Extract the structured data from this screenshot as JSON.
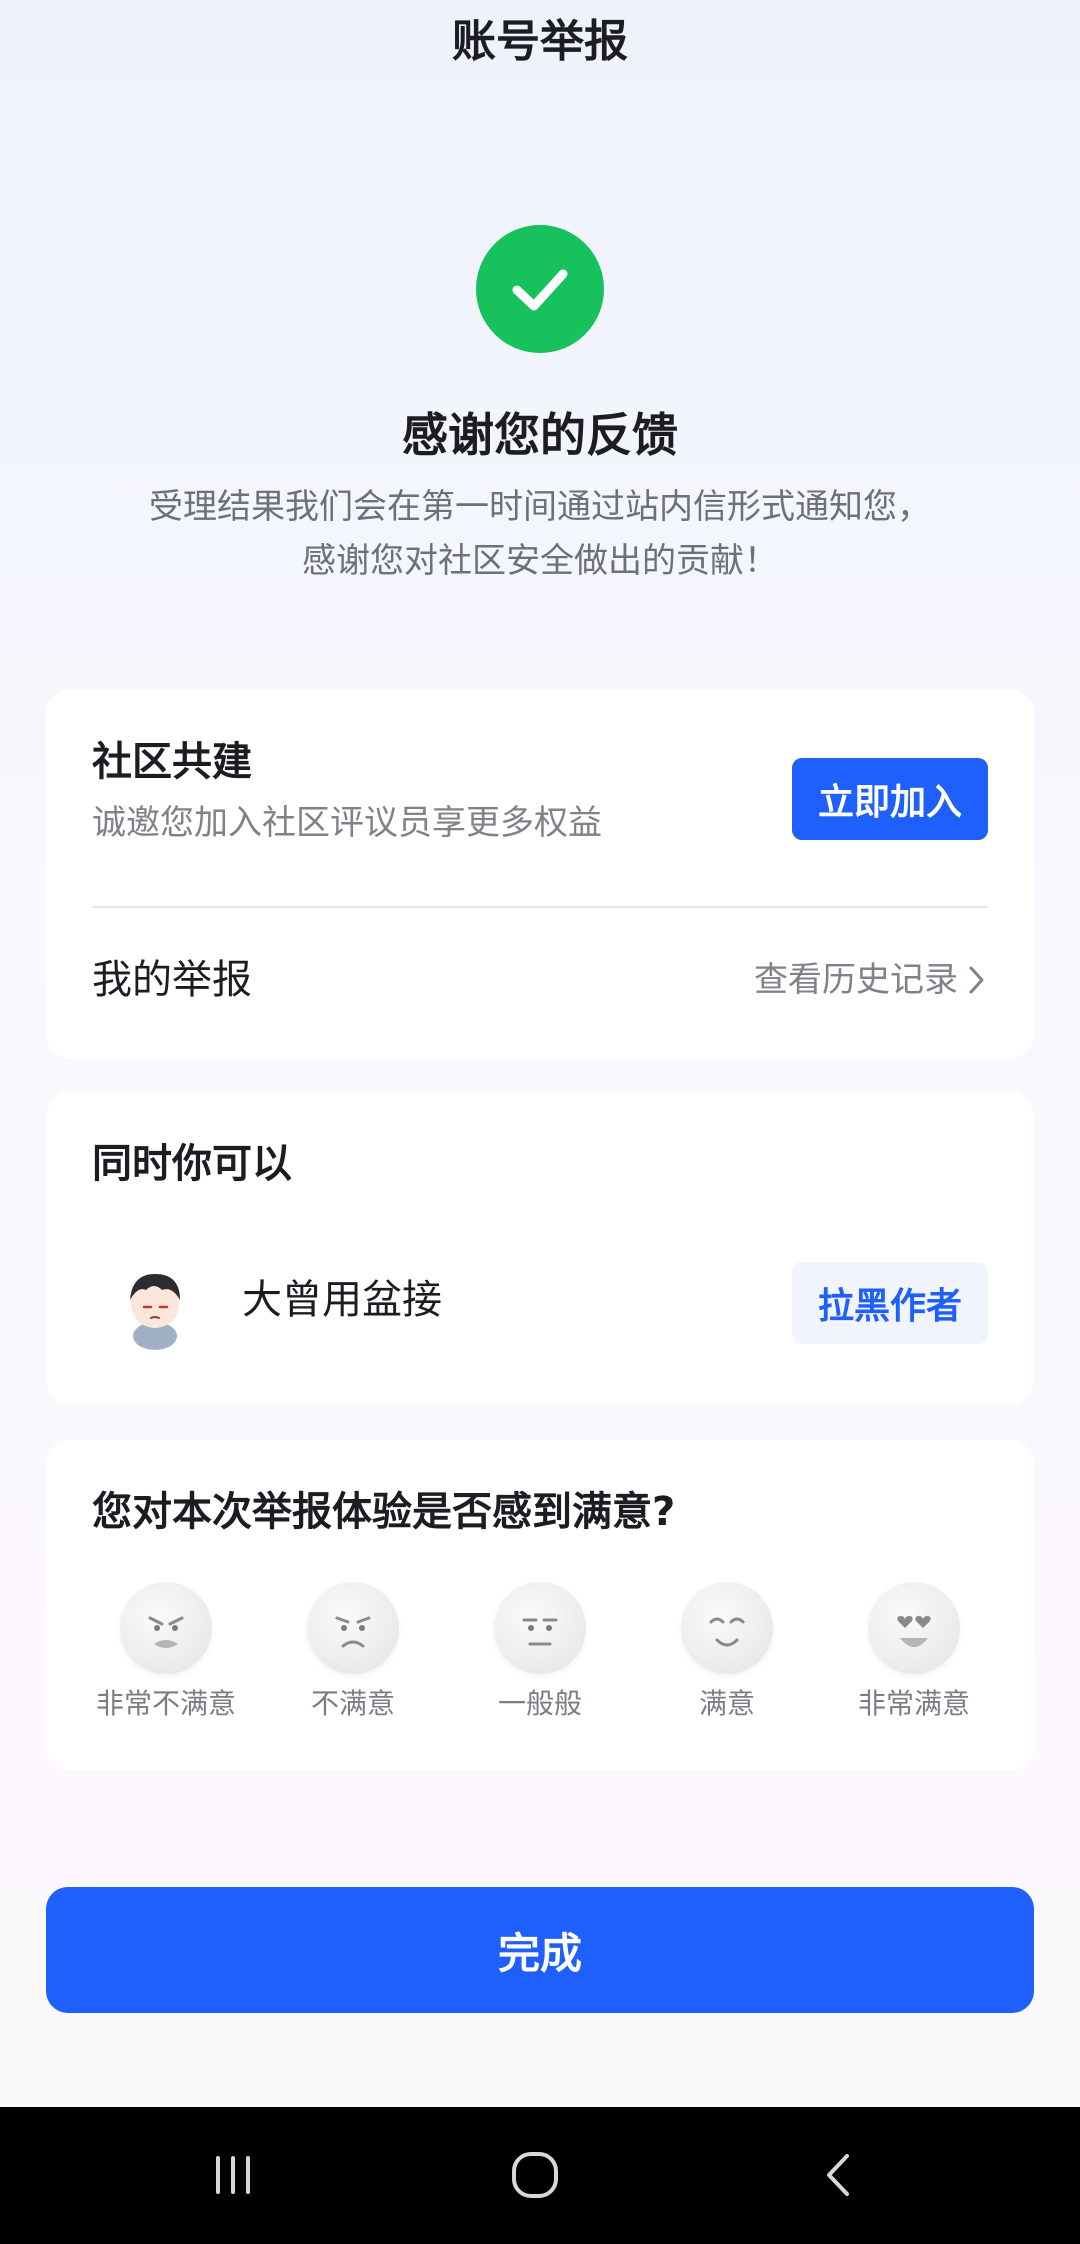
{
  "header": {
    "title": "账号举报"
  },
  "success": {
    "heading": "感谢您的反馈",
    "desc_line1": "受理结果我们会在第一时间通过站内信形式通知您，",
    "desc_line2": "感谢您对社区安全做出的贡献！"
  },
  "community": {
    "title": "社区共建",
    "subtitle": "诚邀您加入社区评议员享更多权益",
    "join_label": "立即加入",
    "my_reports_label": "我的举报",
    "history_label": "查看历史记录"
  },
  "also": {
    "title": "同时你可以",
    "author_name": "大曾用盆接",
    "block_label": "拉黑作者"
  },
  "survey": {
    "question": "您对本次举报体验是否感到满意?",
    "options": [
      {
        "label": "非常不满意",
        "icon": "very-dissatisfied-face-icon"
      },
      {
        "label": "不满意",
        "icon": "dissatisfied-face-icon"
      },
      {
        "label": "一般般",
        "icon": "neutral-face-icon"
      },
      {
        "label": "满意",
        "icon": "satisfied-face-icon"
      },
      {
        "label": "非常满意",
        "icon": "very-satisfied-face-icon"
      }
    ]
  },
  "footer": {
    "done_label": "完成"
  },
  "colors": {
    "accent": "#1f5ffb",
    "success": "#17c15c",
    "navbar": "#000000"
  },
  "system_nav": {
    "icons": [
      "recent-apps-icon",
      "home-icon",
      "back-icon"
    ]
  }
}
